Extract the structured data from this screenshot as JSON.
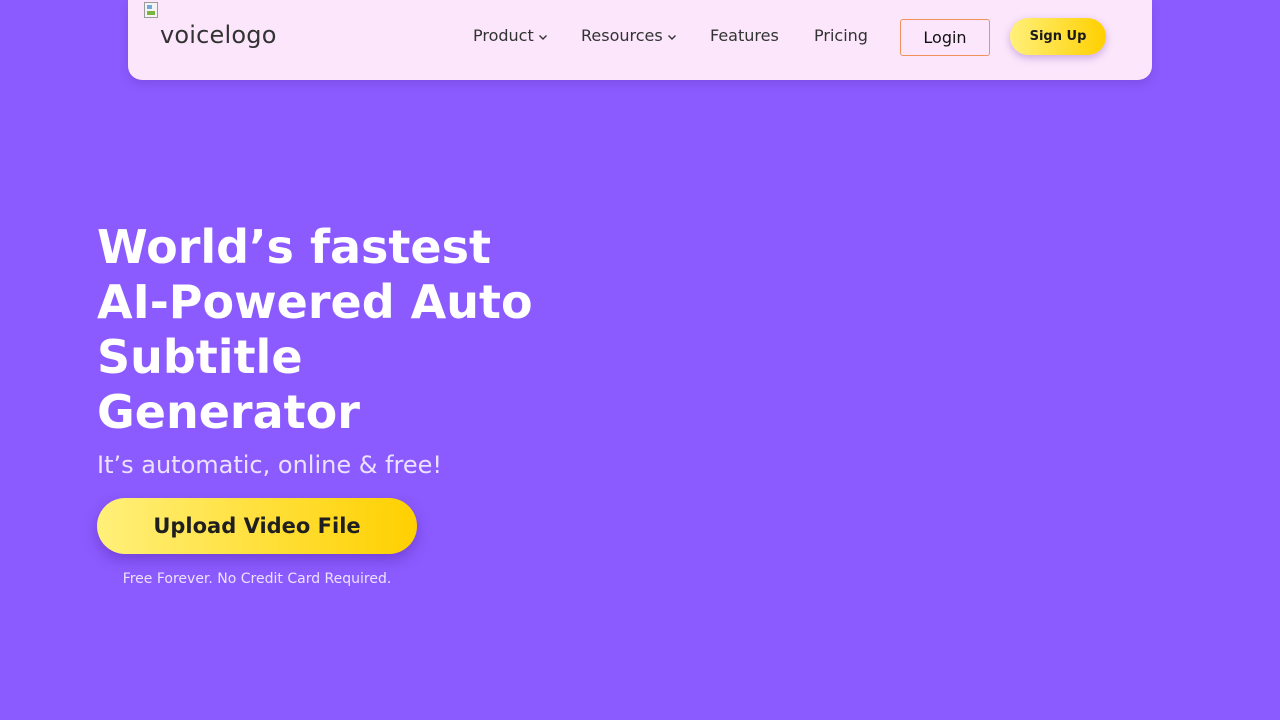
{
  "header": {
    "logo_alt": "voicelogo",
    "nav": [
      {
        "label": "Product",
        "icon": "chevron-down-icon"
      },
      {
        "label": "Resources",
        "icon": "chevron-down-icon"
      },
      {
        "label": "Features"
      },
      {
        "label": "Pricing"
      }
    ],
    "login_label": "Login",
    "signup_label": "Sign Up"
  },
  "hero": {
    "title_lines": [
      "World’s fastest",
      "AI-Powered Auto",
      "Subtitle",
      "Generator"
    ],
    "subtitle": "It’s automatic, online & free!",
    "cta_label": "Upload Video File",
    "note": "Free Forever. No Credit Card Required."
  },
  "colors": {
    "background": "#8c5bff",
    "navbar": "#fbe6fb",
    "cta_gradient_start": "#fff07a",
    "cta_gradient_end": "#ffd000",
    "login_border": "#f0925a"
  }
}
